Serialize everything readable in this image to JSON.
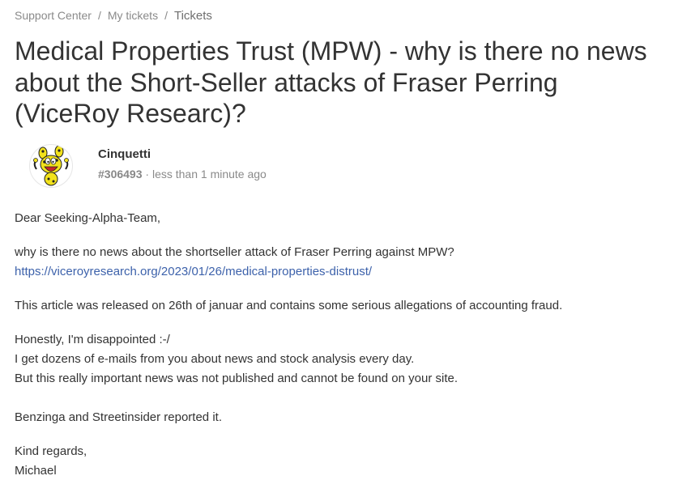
{
  "breadcrumb": {
    "items": [
      "Support Center",
      "My tickets"
    ],
    "separator": "/",
    "current": "Tickets"
  },
  "ticket": {
    "title": "Medical Properties Trust (MPW) - why is there no news about the Short-Seller attacks of Fraser Perring (ViceRoy Researc)?",
    "author": "Cinquetti",
    "id": "#306493",
    "meta_separator": "·",
    "time": "less than 1 minute ago",
    "avatar_icon": "marsupilami-avatar-icon"
  },
  "body": {
    "greeting": "Dear Seeking-Alpha-Team,",
    "question": "why is there no news about the shortseller attack of Fraser Perring against MPW?",
    "link": "https://viceroyresearch.org/2023/01/26/medical-properties-distrust/",
    "article_note": "This article was released on 26th of januar and contains some serious allegations of accounting fraud.",
    "line1": "Honestly, I'm disappointed :-/",
    "line2": "I get dozens of e-mails from you about news and stock analysis every day.",
    "line3": "But this really important news was not published and cannot be found on your site.",
    "line4": "Benzinga and Streetinsider reported it.",
    "closing": "Kind regards,",
    "signature": "Michael"
  },
  "colors": {
    "text": "#333333",
    "muted": "#8a8a8a",
    "link": "#3d62ab",
    "avatar_yellow": "#f2e21b"
  }
}
